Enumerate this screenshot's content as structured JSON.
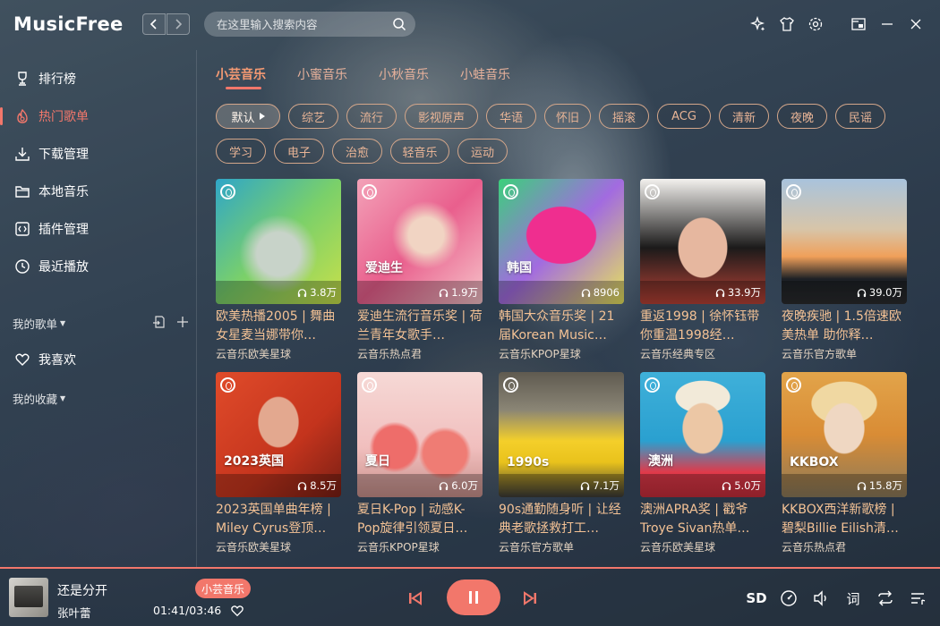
{
  "app": {
    "title": "MusicFree"
  },
  "search": {
    "placeholder": "在这里输入搜索内容"
  },
  "sidebar": {
    "items": [
      {
        "label": "排行榜",
        "icon": "trophy-icon",
        "active": false
      },
      {
        "label": "热门歌单",
        "icon": "fire-icon",
        "active": true
      },
      {
        "label": "下载管理",
        "icon": "download-icon",
        "active": false
      },
      {
        "label": "本地音乐",
        "icon": "folder-icon",
        "active": false
      },
      {
        "label": "插件管理",
        "icon": "plugin-icon",
        "active": false
      },
      {
        "label": "最近播放",
        "icon": "clock-icon",
        "active": false
      }
    ],
    "my_playlists": "我的歌单",
    "favorites": "我喜欢",
    "my_collections": "我的收藏"
  },
  "tabs": [
    {
      "label": "小芸音乐",
      "active": true
    },
    {
      "label": "小蜜音乐",
      "active": false
    },
    {
      "label": "小秋音乐",
      "active": false
    },
    {
      "label": "小蛙音乐",
      "active": false
    }
  ],
  "tags": {
    "default_label": "默认",
    "row1": [
      "综艺",
      "流行",
      "影视原声",
      "华语",
      "怀旧",
      "摇滚",
      "ACG",
      "清新",
      "夜晚",
      "民谣"
    ],
    "row2": [
      "学习",
      "电子",
      "治愈",
      "轻音乐",
      "运动"
    ]
  },
  "playlists": [
    {
      "title": "欧美热播2005 | 舞曲女星麦当娜带你…",
      "creator": "云音乐欧美星球",
      "count": "3.8万",
      "label": ""
    },
    {
      "title": "爱迪生流行音乐奖 | 荷兰青年女歌手…",
      "creator": "云音乐热点君",
      "count": "1.9万",
      "label": "爱迪生"
    },
    {
      "title": "韩国大众音乐奖 | 21届Korean Music…",
      "creator": "云音乐KPOP星球",
      "count": "8906",
      "label": "韩国"
    },
    {
      "title": "重返1998 | 徐怀钰带你重温1998经…",
      "creator": "云音乐经典专区",
      "count": "33.9万",
      "label": ""
    },
    {
      "title": "夜晚疾驰 | 1.5倍速欧美热单 助你释…",
      "creator": "云音乐官方歌单",
      "count": "39.0万",
      "label": ""
    },
    {
      "title": "2023英国单曲年榜 | Miley Cyrus登顶…",
      "creator": "云音乐欧美星球",
      "count": "8.5万",
      "label": "2023英国"
    },
    {
      "title": "夏日K-Pop | 动感K-Pop旋律引领夏日…",
      "creator": "云音乐KPOP星球",
      "count": "6.0万",
      "label": "夏日"
    },
    {
      "title": "90s通勤随身听 | 让经典老歌拯救打工…",
      "creator": "云音乐官方歌单",
      "count": "7.1万",
      "label": "1990s"
    },
    {
      "title": "澳洲APRA奖 | 戳爷Troye Sivan热单…",
      "creator": "云音乐欧美星球",
      "count": "5.0万",
      "label": "澳洲"
    },
    {
      "title": "KKBOX西洋新歌榜 | 碧梨Billie Eilish清…",
      "creator": "云音乐热点君",
      "count": "15.8万",
      "label": "KKBOX"
    }
  ],
  "player": {
    "song": "还是分开",
    "artist": "张叶蕾",
    "source_badge": "小芸音乐",
    "time": "01:41/03:46",
    "quality": "SD",
    "lyrics_label": "词"
  }
}
